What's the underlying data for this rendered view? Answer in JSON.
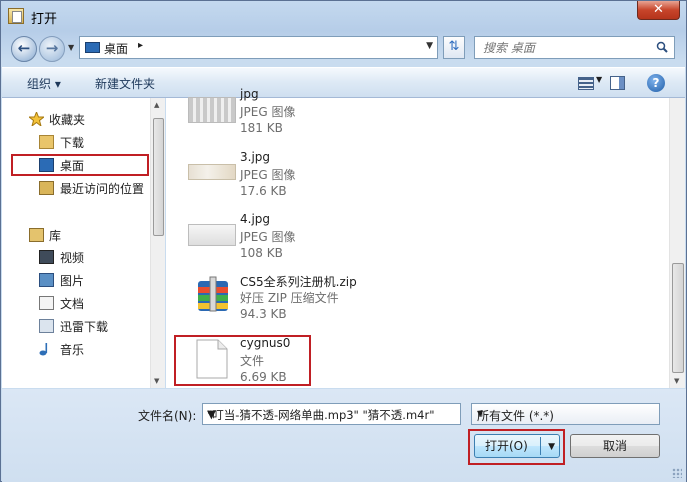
{
  "window": {
    "title": "打开",
    "close_label": "✕"
  },
  "address": {
    "location": "桌面",
    "chevron": "▸"
  },
  "search": {
    "placeholder": "搜索 桌面"
  },
  "toolbar": {
    "organize_label": "组织 ▾",
    "new_folder_label": "新建文件夹"
  },
  "navpane": {
    "favorites": "收藏夹",
    "items": [
      {
        "label": "下载",
        "icon": "download-folder-icon"
      },
      {
        "label": "桌面",
        "icon": "desktop-icon"
      },
      {
        "label": "最近访问的位置",
        "icon": "recent-places-icon"
      }
    ],
    "library": "库",
    "library_items": [
      {
        "label": "视频",
        "icon": "video-library-icon"
      },
      {
        "label": "图片",
        "icon": "picture-library-icon"
      },
      {
        "label": "文档",
        "icon": "document-library-icon"
      },
      {
        "label": "迅雷下载",
        "icon": "thunder-download-icon"
      },
      {
        "label": "音乐",
        "icon": "music-library-icon"
      }
    ]
  },
  "files": [
    {
      "name": "jpg",
      "type": "JPEG 图像",
      "size": "181 KB",
      "icon": "jpeg-thumbnail-icon"
    },
    {
      "name": "3.jpg",
      "type": "JPEG 图像",
      "size": "17.6 KB",
      "icon": "jpeg-thumbnail-icon"
    },
    {
      "name": "4.jpg",
      "type": "JPEG 图像",
      "size": "108 KB",
      "icon": "jpeg-thumbnail-icon"
    },
    {
      "name": "CS5全系列注册机.zip",
      "type": "好压 ZIP 压缩文件",
      "size": "94.3 KB",
      "icon": "zip-archive-icon"
    },
    {
      "name": "cygnus0",
      "type": "文件",
      "size": "6.69 KB",
      "icon": "generic-file-icon"
    }
  ],
  "bottom": {
    "filename_label": "文件名(N):",
    "filename_value": "\"叮当-猜不透-网络单曲.mp3\" \"猜不透.m4r\"",
    "filetype_value": "所有文件 (*.*)",
    "open_label": "打开(O)",
    "cancel_label": "取消"
  },
  "colors": {
    "highlight_box": "#c01f24",
    "accent": "#2b6bb5"
  }
}
